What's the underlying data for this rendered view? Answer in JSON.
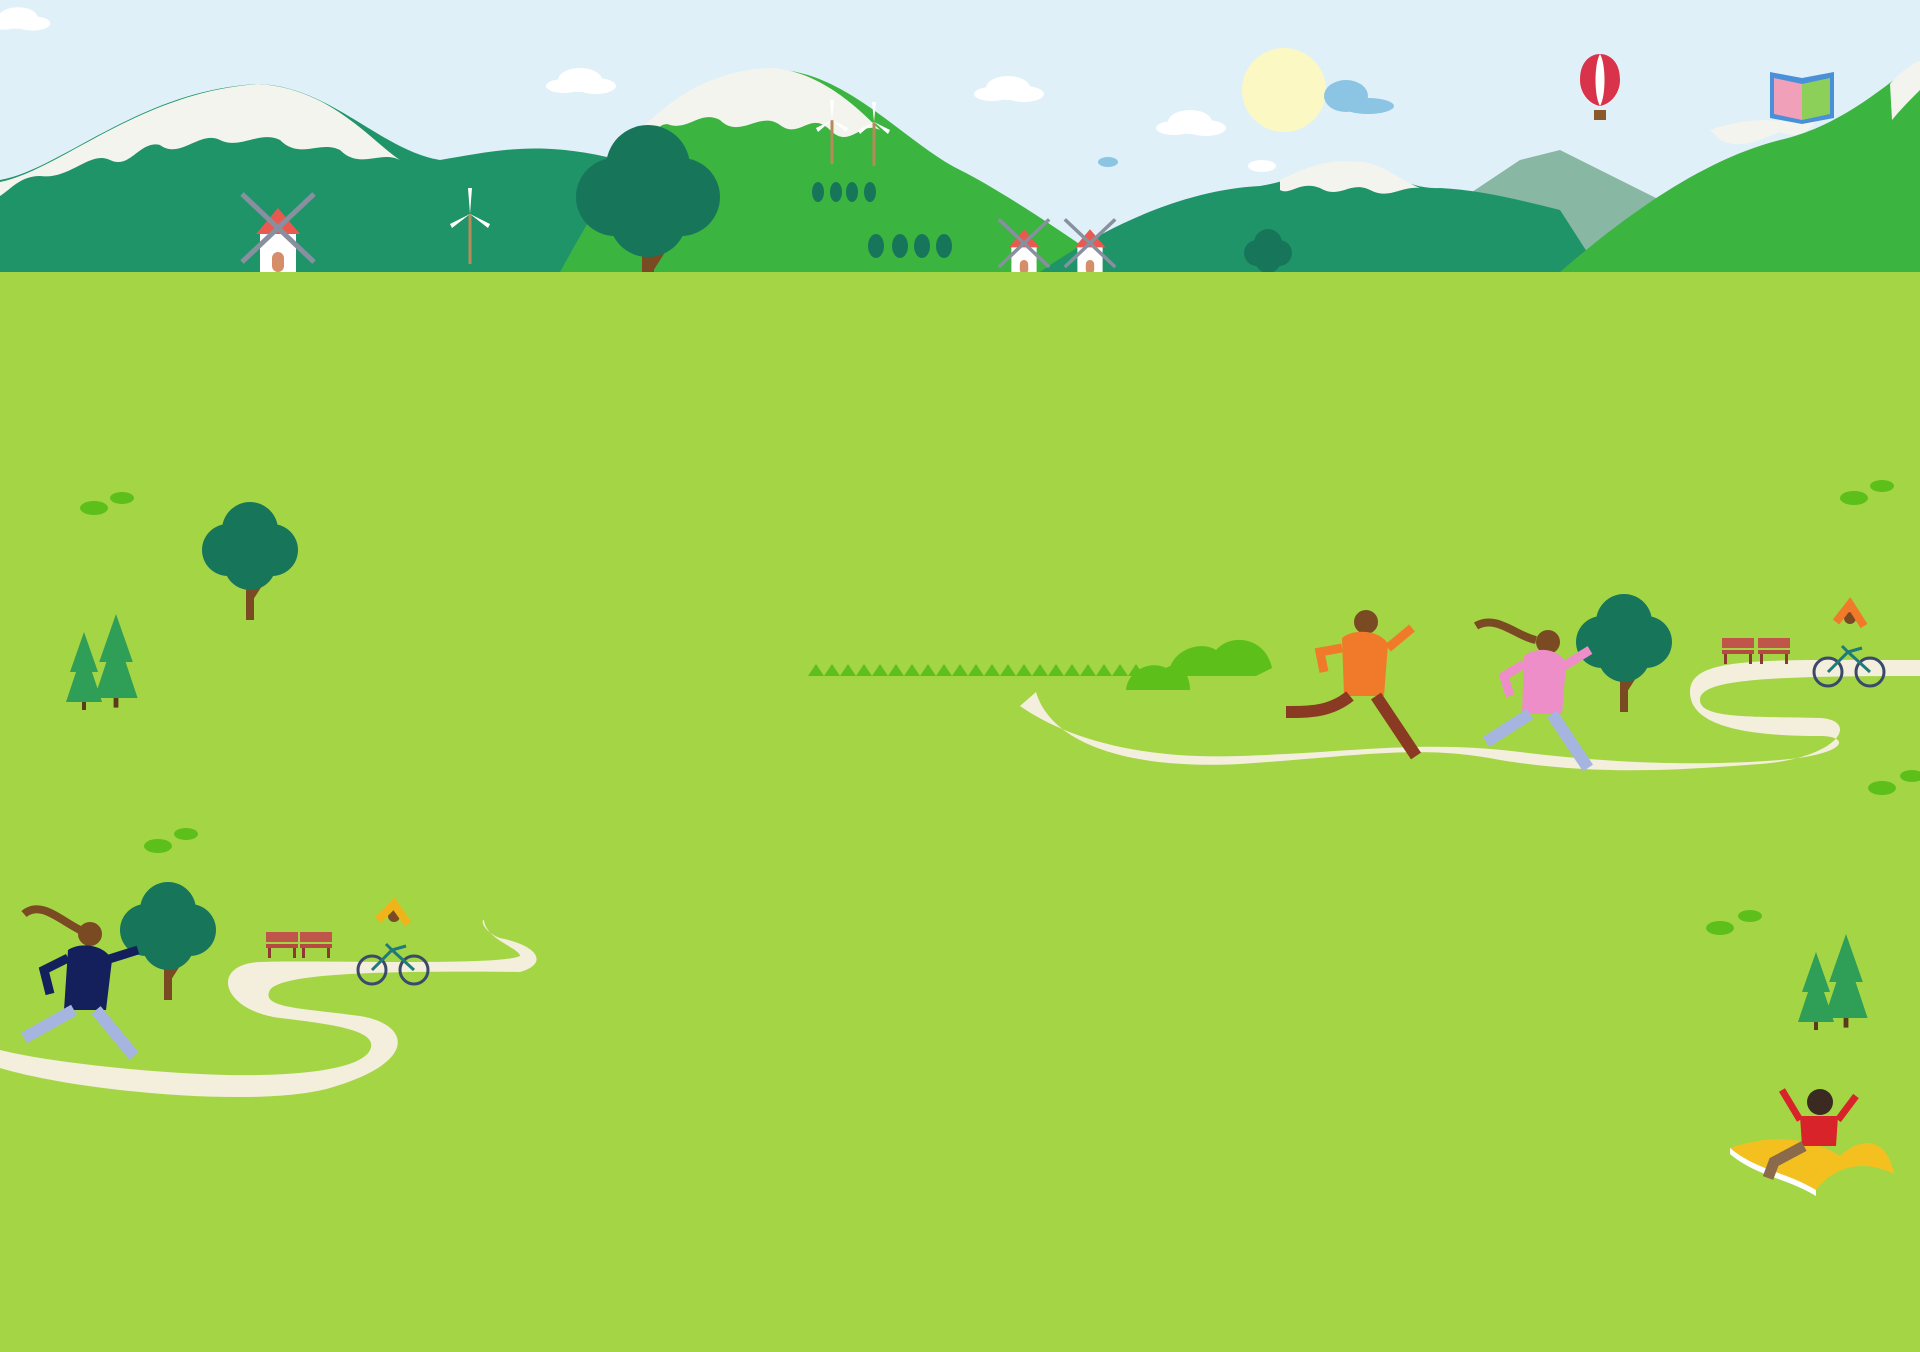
{
  "scene": {
    "title": "",
    "colors": {
      "sky": "#dff0f8",
      "grass": "#a4d545",
      "mountain_dark": "#1e9468",
      "mountain_bright": "#3bb440",
      "mountain_misty": "#88b8a4",
      "snow": "#f4f4ee",
      "path": "#f4eedc",
      "tree_canopy": "#17765a",
      "tree_trunk": "#7a4a22",
      "sun": "#fbf8c4",
      "bush": "#5dbf1a"
    },
    "elements": [
      "windmill-icon",
      "wind-turbine-icon",
      "hot-air-balloon-icon",
      "open-book-icon",
      "tree-icon",
      "pine-tree-icon",
      "bench-icon",
      "cyclist-icon",
      "runner-icon",
      "child-on-book-icon",
      "sun-icon",
      "cloud-icon",
      "bush-icon",
      "winding-path"
    ]
  }
}
